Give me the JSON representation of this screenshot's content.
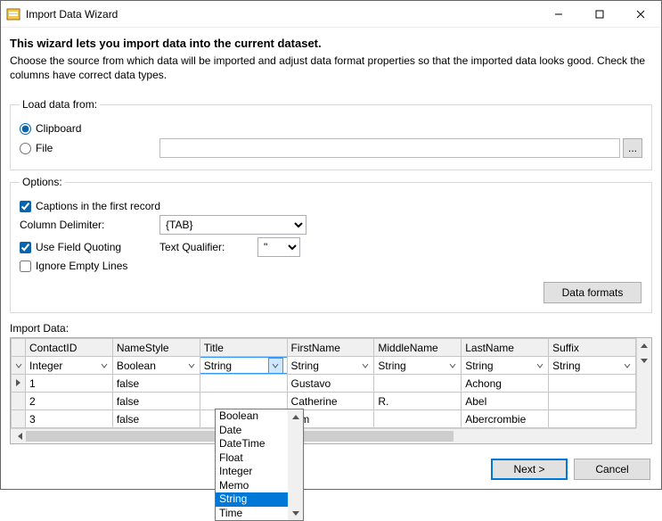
{
  "window": {
    "title": "Import Data Wizard"
  },
  "heading": {
    "title": "This wizard lets you import data into the current dataset.",
    "subtitle": "Choose the source from which data will be imported and adjust data format properties so that the imported data looks good. Check the columns have correct data types."
  },
  "load": {
    "legend": "Load data from:",
    "clipboard": "Clipboard",
    "file": "File",
    "file_path": "",
    "browse": "..."
  },
  "options": {
    "legend": "Options:",
    "captions": "Captions in the first record",
    "delim_label": "Column Delimiter:",
    "delim_value": "{TAB}",
    "quoting": "Use Field Quoting",
    "qualifier_label": "Text Qualifier:",
    "qualifier_value": "\"",
    "ignore_empty": "Ignore Empty Lines",
    "data_formats": "Data formats"
  },
  "grid": {
    "label": "Import Data:",
    "columns": [
      "ContactID",
      "NameStyle",
      "Title",
      "FirstName",
      "MiddleName",
      "LastName",
      "Suffix"
    ],
    "types": [
      "Integer",
      "Boolean",
      "String",
      "String",
      "String",
      "String",
      "String"
    ],
    "rows": [
      [
        "1",
        "false",
        "",
        "Gustavo",
        "",
        "Achong",
        ""
      ],
      [
        "2",
        "false",
        "",
        "Catherine",
        "R.",
        "Abel",
        ""
      ],
      [
        "3",
        "false",
        "",
        "Kim",
        "",
        "Abercrombie",
        ""
      ]
    ],
    "type_options": [
      "Boolean",
      "Date",
      "DateTime",
      "Float",
      "Integer",
      "Memo",
      "String",
      "Time"
    ],
    "open_column_index": 2,
    "selected_option": "String"
  },
  "footer": {
    "next": "Next >",
    "cancel": "Cancel"
  }
}
